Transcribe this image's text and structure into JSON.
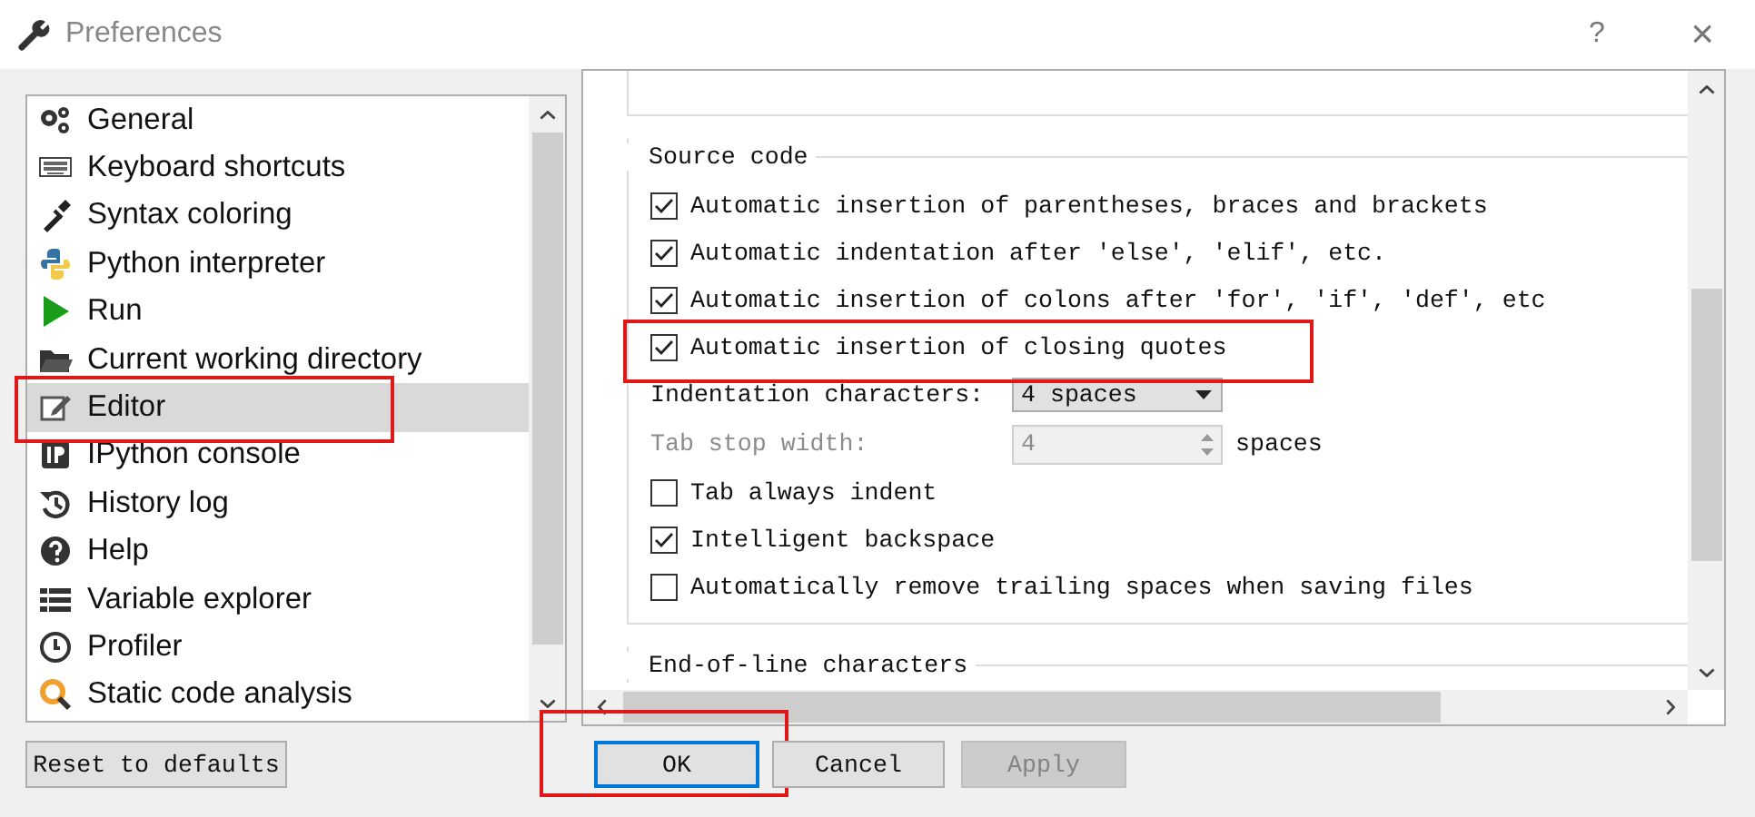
{
  "window": {
    "title": "Preferences",
    "help": "?",
    "close": "×"
  },
  "nav_items": [
    {
      "label": "General",
      "selected": false,
      "highlighted": false
    },
    {
      "label": "Keyboard shortcuts",
      "selected": false,
      "highlighted": false
    },
    {
      "label": "Syntax coloring",
      "selected": false,
      "highlighted": false
    },
    {
      "label": "Python interpreter",
      "selected": false,
      "highlighted": false
    },
    {
      "label": "Run",
      "selected": false,
      "highlighted": false
    },
    {
      "label": "Current working directory",
      "selected": false,
      "highlighted": false
    },
    {
      "label": "Editor",
      "selected": true,
      "highlighted": true
    },
    {
      "label": "IPython console",
      "selected": false,
      "highlighted": false
    },
    {
      "label": "History log",
      "selected": false,
      "highlighted": false
    },
    {
      "label": "Help",
      "selected": false,
      "highlighted": false
    },
    {
      "label": "Variable explorer",
      "selected": false,
      "highlighted": false
    },
    {
      "label": "Profiler",
      "selected": false,
      "highlighted": false
    },
    {
      "label": "Static code analysis",
      "selected": false,
      "highlighted": false
    }
  ],
  "source_code": {
    "title": "Source code",
    "options_top": [
      {
        "label": "Automatic insertion of parentheses, braces and brackets",
        "checked": true,
        "highlighted": false
      },
      {
        "label": "Automatic indentation after 'else', 'elif', etc.",
        "checked": true,
        "highlighted": false
      },
      {
        "label": "Automatic insertion of colons after 'for', 'if', 'def', etc",
        "checked": true,
        "highlighted": false
      },
      {
        "label": "Automatic insertion of closing quotes",
        "checked": true,
        "highlighted": true
      }
    ],
    "indentation": {
      "label": "Indentation characters:",
      "value": "4 spaces"
    },
    "tab_stop": {
      "label": "Tab stop width:",
      "value": "4",
      "unit": "spaces",
      "disabled": true
    },
    "options_bottom": [
      {
        "label": "Tab always indent",
        "checked": false,
        "highlighted": false
      },
      {
        "label": "Intelligent backspace",
        "checked": true,
        "highlighted": false
      },
      {
        "label": "Automatically remove trailing spaces when saving files",
        "checked": false,
        "highlighted": false
      }
    ]
  },
  "end_of_line": {
    "title": "End-of-line characters"
  },
  "buttons": [
    {
      "label": "Reset to defaults",
      "default": false,
      "disabled": false,
      "highlighted": false
    },
    {
      "label": "OK",
      "default": true,
      "disabled": false,
      "highlighted": true
    },
    {
      "label": "Cancel",
      "default": false,
      "disabled": false,
      "highlighted": false
    },
    {
      "label": "Apply",
      "default": false,
      "disabled": true,
      "highlighted": false
    }
  ]
}
